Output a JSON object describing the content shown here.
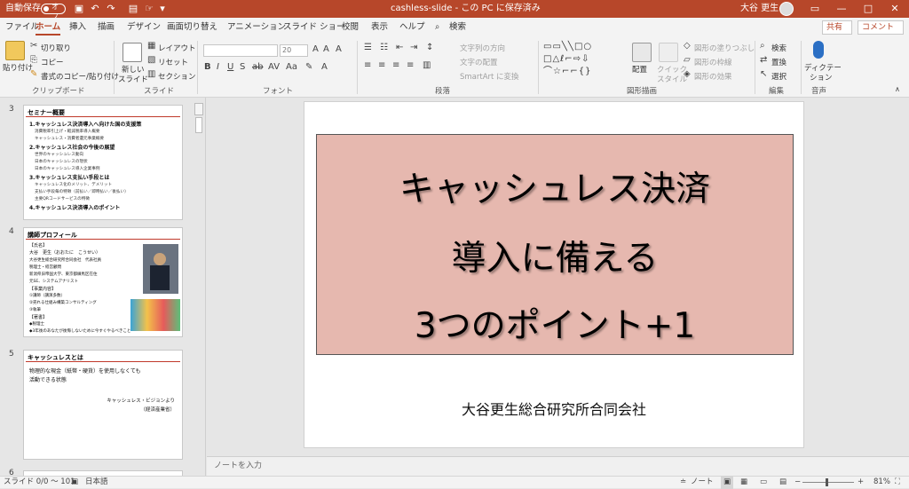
{
  "titlebar": {
    "autosave_label": "自動保存",
    "autosave_state": "オフ",
    "doc_title": "cashless-slide - この PC に保存済み",
    "user_name": "大谷 更生",
    "accent_color": "#b7472a"
  },
  "tabs": [
    "ファイル",
    "ホーム",
    "挿入",
    "描画",
    "デザイン",
    "画面切り替え",
    "アニメーション",
    "スライド ショー",
    "校閲",
    "表示",
    "ヘルプ",
    "検索"
  ],
  "active_tab": "ホーム",
  "share_label": "共有",
  "comment_label": "コメント",
  "ribbon": {
    "clipboard": {
      "paste": "貼り付け",
      "cut": "切り取り",
      "copy": "コピー",
      "format_painter": "書式のコピー/貼り付け",
      "label": "クリップボード"
    },
    "slides": {
      "new_slide": "新しい",
      "new_slide2": "スライド",
      "layout": "レイアウト",
      "reset": "リセット",
      "section": "セクション",
      "label": "スライド"
    },
    "font": {
      "font_size": "20",
      "label": "フォント"
    },
    "paragraph": {
      "text_direction": "文字列の方向",
      "align_text": "文字の配置",
      "smartart": "SmartArt に変換",
      "label": "段落"
    },
    "drawing": {
      "arrange": "配置",
      "quick_styles": "クイック",
      "quick_styles2": "スタイル",
      "shape_fill": "図形の塗りつぶし",
      "shape_outline": "図形の枠線",
      "shape_effects": "図形の効果",
      "label": "図形描画"
    },
    "editing": {
      "find": "検索",
      "replace": "置換",
      "select": "選択",
      "label": "編集"
    },
    "voice": {
      "dictate": "ディクテー",
      "dictate2": "ション",
      "label": "音声"
    }
  },
  "thumbnails": [
    {
      "number": "3",
      "title": "セミナー概要",
      "lines": [
        {
          "t": "1.キャッシュレス決済導入へ向けた国の支援策",
          "k": "b"
        },
        {
          "t": "消費税率引上げ・軽減税率導入概要",
          "k": "s"
        },
        {
          "t": "キャッシュレス・消費者還元事業概要",
          "k": "s"
        },
        {
          "t": "2.キャッシュレス社会の今後の展望",
          "k": "b"
        },
        {
          "t": "世界のキャッシュレス動向",
          "k": "s"
        },
        {
          "t": "日本のキャッシュレスの現状",
          "k": "s"
        },
        {
          "t": "日本のキャッシュレス導入企業事例",
          "k": "s"
        },
        {
          "t": "3.キャッシュレス支払い手段とは",
          "k": "b"
        },
        {
          "t": "キャッシュレス化のメリット、デメリット",
          "k": "s"
        },
        {
          "t": "支払い手段毎の特徴（前払い／即時払い／後払い）",
          "k": "s"
        },
        {
          "t": "主要QRコードサービスの特徴",
          "k": "s"
        },
        {
          "t": "4.キャッシュレス決済導入のポイント",
          "k": "b"
        }
      ]
    },
    {
      "number": "4",
      "title": "講師プロフィール",
      "lines": [
        {
          "t": "【氏名】",
          "k": "n"
        },
        {
          "t": "大谷　更生（おおたに　こうせい）",
          "k": "n"
        },
        {
          "t": "大谷更生総合研究所合同会社　代表社員",
          "k": "s"
        },
        {
          "t": "税理士・経営顧問",
          "k": "s"
        },
        {
          "t": "新潟県旧帝国大学、東京都練馬区在住",
          "k": "s"
        },
        {
          "t": "元SE、システムアナリスト",
          "k": "s"
        },
        {
          "t": "【事業内容】",
          "k": "n"
        },
        {
          "t": "①講師（講演多数）",
          "k": "s"
        },
        {
          "t": "②売れる仕組み構築コンサルティング",
          "k": "s"
        },
        {
          "t": "③執筆",
          "k": "s"
        },
        {
          "t": "【著書】",
          "k": "n"
        },
        {
          "t": "◆税理士",
          "k": "s"
        },
        {
          "t": "◆3年後のあなたが後悔しないために今すぐやるべきこと",
          "k": "s"
        }
      ]
    },
    {
      "number": "5",
      "title": "キャッシュレスとは",
      "lines": [
        {
          "t": "物理的な現金（紙幣・硬貨）を使用しなくても",
          "k": "n"
        },
        {
          "t": "活動できる状態",
          "k": "n"
        },
        {
          "t": "キャッシュレス・ビジョンより",
          "k": "r"
        },
        {
          "t": "（経済産業省）",
          "k": "r"
        }
      ]
    },
    {
      "number": "6"
    }
  ],
  "slide": {
    "title_lines": [
      "キャッシュレス決済",
      "導入に備える",
      "3つのポイント+1"
    ],
    "company": "大谷更生総合研究所合同会社",
    "title_box_color": "#e6b8af"
  },
  "notes_placeholder": "ノートを入力",
  "status": {
    "slide_counter": "スライド 0/0 ～ 101",
    "language": "日本語",
    "notes_label": "ノート",
    "zoom": "81%"
  }
}
